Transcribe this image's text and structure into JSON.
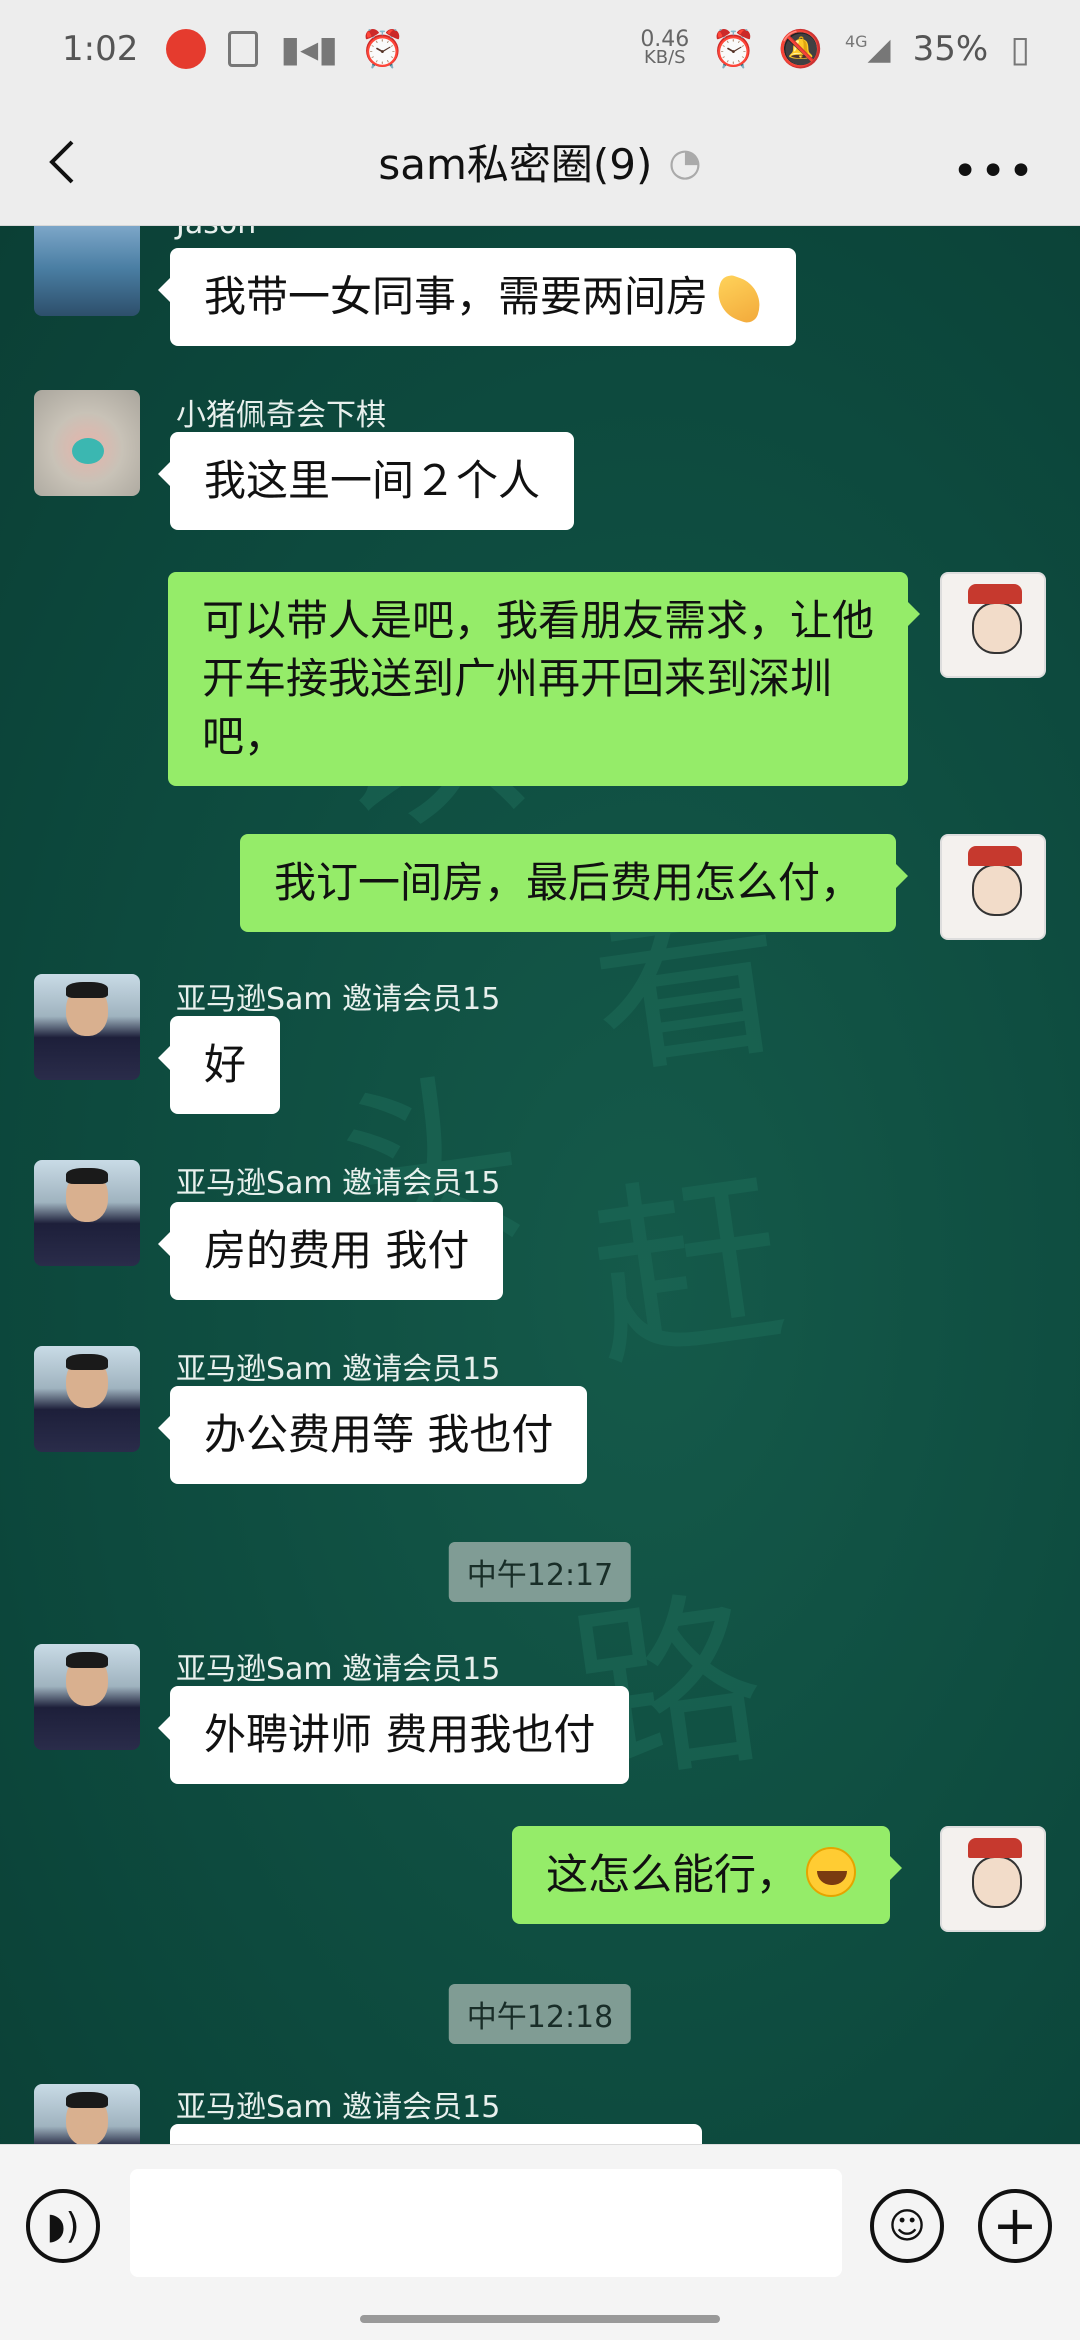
{
  "status_bar": {
    "time": "1:02",
    "net_speed_value": "0.46",
    "net_speed_unit": "KB/S",
    "network": "4G",
    "battery": "35%",
    "icons": [
      "app-notification-icon",
      "document-icon",
      "video-icon",
      "alarm-icon",
      "alarm-icon",
      "mute-icon",
      "signal-icon",
      "battery-icon"
    ]
  },
  "nav": {
    "title": "sam私密圈(9)",
    "back_icon": "chevron-left-icon",
    "ear_icon": "earpiece-icon",
    "more_icon": "more-dots-icon"
  },
  "watermark": [
    "以",
    "看",
    "头",
    "赶",
    "路"
  ],
  "messages": [
    {
      "sender": "Jason",
      "text": "我带一女同事，需要两间房",
      "emoji": "hand-emoji",
      "direction": "in"
    },
    {
      "sender": "小猪佩奇会下棋",
      "text": "我这里一间２个人",
      "direction": "in"
    },
    {
      "text": "可以带人是吧，我看朋友需求，让他开车接我送到广州再开回来到深圳吧，",
      "direction": "out"
    },
    {
      "text": "我订一间房，最后费用怎么付，",
      "direction": "out"
    },
    {
      "sender": "亚马逊Sam 邀请会员15",
      "text": "好",
      "direction": "in"
    },
    {
      "sender": "亚马逊Sam 邀请会员15",
      "text": "房的费用 我付",
      "direction": "in"
    },
    {
      "sender": "亚马逊Sam 邀请会员15",
      "text": "办公费用等 我也付",
      "direction": "in"
    },
    {
      "time": "中午12:17"
    },
    {
      "sender": "亚马逊Sam 邀请会员15",
      "text": "外聘讲师 费用我也付",
      "direction": "in"
    },
    {
      "text": "这怎么能行，",
      "emoji": "laughing-crying-emoji",
      "direction": "out"
    },
    {
      "time": "中午12:18"
    },
    {
      "sender": "亚马逊Sam 邀请会员15",
      "text": "",
      "direction": "in"
    }
  ],
  "input_bar": {
    "text_value": "",
    "voice_icon": "voice-icon",
    "emoji_icon": "emoji-face-icon",
    "plus_icon": "plus-icon"
  }
}
